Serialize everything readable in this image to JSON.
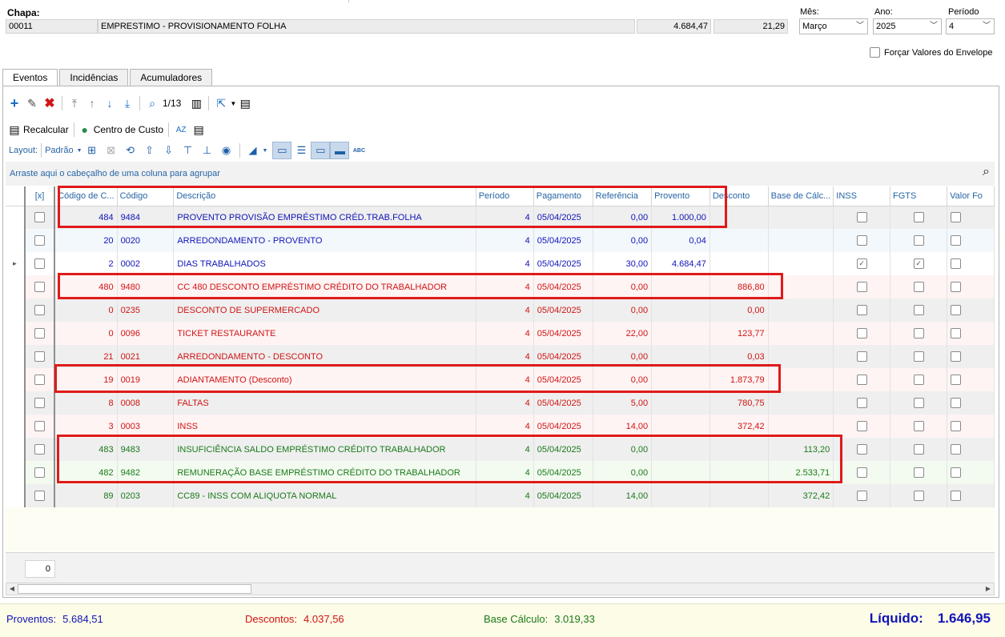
{
  "header": {
    "chapa_label": "Chapa:",
    "chapa_value": "00011",
    "description": "EMPRESTIMO - PROVISIONAMENTO FOLHA",
    "value1": "4.684,47",
    "value2": "21,29",
    "mes_label": "Mês:",
    "mes_value": "Março",
    "ano_label": "Ano:",
    "ano_value": "2025",
    "periodo_label": "Período",
    "periodo_value": "4",
    "forcar_label": "Forçar Valores do Envelope"
  },
  "tabs": [
    {
      "label": "Eventos"
    },
    {
      "label": "Incidências"
    },
    {
      "label": "Acumuladores"
    }
  ],
  "toolbar": {
    "page_counter": "1/13",
    "recalcular_label": "Recalcular",
    "centro_label": "Centro de Custo"
  },
  "layout_bar": {
    "layout_label": "Layout:",
    "layout_value": "Padrão"
  },
  "group_hint": "Arraste aqui o cabeçalho de uma coluna para agrupar",
  "columns": [
    "[x]",
    "Código de C...",
    "Código",
    "Descrição",
    "Período",
    "Pagamento",
    "Referência",
    "Provento",
    "Desconto",
    "Base de Cálc...",
    "INSS",
    "FGTS",
    "Valor Fo"
  ],
  "rows": [
    {
      "cod_c": "484",
      "codigo": "9484",
      "descricao": "PROVENTO PROVISÃO EMPRÉSTIMO CRÉD.TRAB.FOLHA",
      "periodo": "4",
      "pagamento": "05/04/2025",
      "referencia": "0,00",
      "provento": "1.000,00",
      "desconto": "",
      "base": "",
      "inss": false,
      "fgts": false,
      "color": "blue"
    },
    {
      "cod_c": "20",
      "codigo": "0020",
      "descricao": "ARREDONDAMENTO - PROVENTO",
      "periodo": "4",
      "pagamento": "05/04/2025",
      "referencia": "0,00",
      "provento": "0,04",
      "desconto": "",
      "base": "",
      "inss": false,
      "fgts": false,
      "color": "blue"
    },
    {
      "cod_c": "2",
      "codigo": "0002",
      "descricao": "DIAS TRABALHADOS",
      "periodo": "4",
      "pagamento": "05/04/2025",
      "referencia": "30,00",
      "provento": "4.684,47",
      "desconto": "",
      "base": "",
      "inss": true,
      "fgts": true,
      "color": "blue"
    },
    {
      "cod_c": "480",
      "codigo": "9480",
      "descricao": "CC 480 DESCONTO EMPRÉSTIMO CRÉDITO DO TRABALHADOR",
      "periodo": "4",
      "pagamento": "05/04/2025",
      "referencia": "0,00",
      "provento": "",
      "desconto": "886,80",
      "base": "",
      "inss": false,
      "fgts": false,
      "color": "red"
    },
    {
      "cod_c": "0",
      "codigo": "0235",
      "descricao": "DESCONTO DE SUPERMERCADO",
      "periodo": "4",
      "pagamento": "05/04/2025",
      "referencia": "0,00",
      "provento": "",
      "desconto": "0,00",
      "base": "",
      "inss": false,
      "fgts": false,
      "color": "red"
    },
    {
      "cod_c": "0",
      "codigo": "0096",
      "descricao": "TICKET RESTAURANTE",
      "periodo": "4",
      "pagamento": "05/04/2025",
      "referencia": "22,00",
      "provento": "",
      "desconto": "123,77",
      "base": "",
      "inss": false,
      "fgts": false,
      "color": "red"
    },
    {
      "cod_c": "21",
      "codigo": "0021",
      "descricao": "ARREDONDAMENTO - DESCONTO",
      "periodo": "4",
      "pagamento": "05/04/2025",
      "referencia": "0,00",
      "provento": "",
      "desconto": "0,03",
      "base": "",
      "inss": false,
      "fgts": false,
      "color": "red"
    },
    {
      "cod_c": "19",
      "codigo": "0019",
      "descricao": "ADIANTAMENTO (Desconto)",
      "periodo": "4",
      "pagamento": "05/04/2025",
      "referencia": "0,00",
      "provento": "",
      "desconto": "1.873,79",
      "base": "",
      "inss": false,
      "fgts": false,
      "color": "red"
    },
    {
      "cod_c": "8",
      "codigo": "0008",
      "descricao": "FALTAS",
      "periodo": "4",
      "pagamento": "05/04/2025",
      "referencia": "5,00",
      "provento": "",
      "desconto": "780,75",
      "base": "",
      "inss": false,
      "fgts": false,
      "color": "red"
    },
    {
      "cod_c": "3",
      "codigo": "0003",
      "descricao": "INSS",
      "periodo": "4",
      "pagamento": "05/04/2025",
      "referencia": "14,00",
      "provento": "",
      "desconto": "372,42",
      "base": "",
      "inss": false,
      "fgts": false,
      "color": "red"
    },
    {
      "cod_c": "483",
      "codigo": "9483",
      "descricao": "INSUFICIÊNCIA SALDO EMPRÉSTIMO CRÉDITO TRABALHADOR",
      "periodo": "4",
      "pagamento": "05/04/2025",
      "referencia": "0,00",
      "provento": "",
      "desconto": "",
      "base": "113,20",
      "inss": false,
      "fgts": false,
      "color": "green"
    },
    {
      "cod_c": "482",
      "codigo": "9482",
      "descricao": "REMUNERAÇÃO BASE EMPRÉSTIMO CRÉDITO DO TRABALHADOR",
      "periodo": "4",
      "pagamento": "05/04/2025",
      "referencia": "0,00",
      "provento": "",
      "desconto": "",
      "base": "2.533,71",
      "inss": false,
      "fgts": false,
      "color": "green"
    },
    {
      "cod_c": "89",
      "codigo": "0203",
      "descricao": "CC89 - INSS COM ALIQUOTA NORMAL",
      "periodo": "4",
      "pagamento": "05/04/2025",
      "referencia": "14,00",
      "provento": "",
      "desconto": "",
      "base": "372,42",
      "inss": false,
      "fgts": false,
      "color": "green"
    }
  ],
  "footer": {
    "count": "0"
  },
  "totals": {
    "proventos_label": "Proventos:",
    "proventos_value": "5.684,51",
    "descontos_label": "Descontos:",
    "descontos_value": "4.037,56",
    "base_label": "Base Cálculo:",
    "base_value": "3.019,33",
    "liquido_label": "Líquido:",
    "liquido_value": "1.646,95"
  },
  "colors": {
    "provento": "#1014b8",
    "desconto": "#d11414",
    "base": "#1a7a1a",
    "highlight_box": "#e01a1a"
  }
}
